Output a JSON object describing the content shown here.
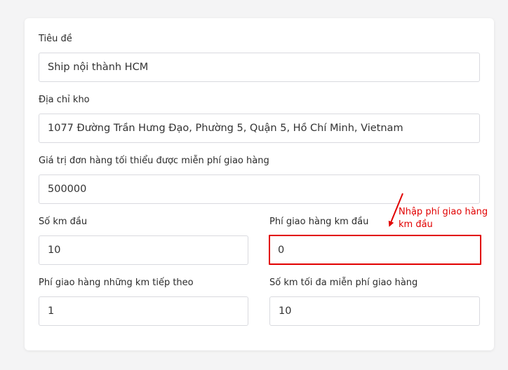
{
  "form": {
    "title": {
      "label": "Tiêu đề",
      "value": "Ship nội thành HCM"
    },
    "warehouse_address": {
      "label": "Địa chỉ kho",
      "value": "1077 Đường Trần Hưng Đạo, Phường 5, Quận 5, Hồ Chí Minh, Vietnam"
    },
    "min_order_free_shipping": {
      "label": "Giá trị đơn hàng tối thiểu được miễn phí giao hàng",
      "value": "500000"
    },
    "first_km": {
      "label": "Số km đầu",
      "value": "10"
    },
    "first_km_fee": {
      "label": "Phí giao hàng km đầu",
      "value": "0"
    },
    "next_km_fee": {
      "label": "Phí giao hàng những km tiếp theo",
      "value": "1"
    },
    "max_free_km": {
      "label": "Số km tối đa miễn phí giao hàng",
      "value": "10"
    }
  },
  "annotation": {
    "text_line1": "Nhập phí giao hàng",
    "text_line2": "km đầu",
    "color": "#e10000"
  }
}
